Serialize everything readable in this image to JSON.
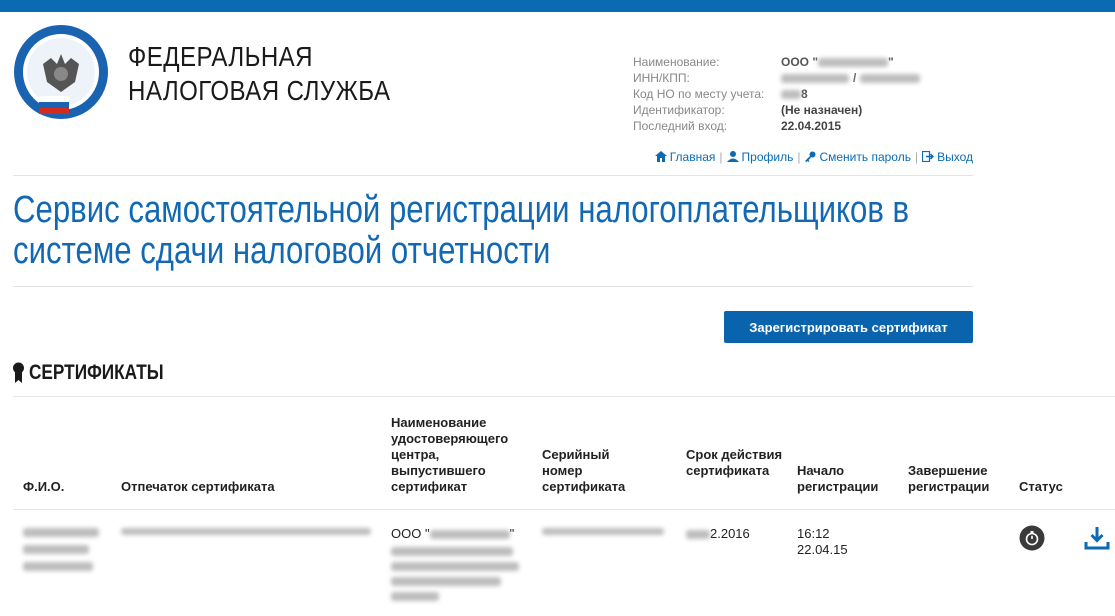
{
  "header": {
    "brand_line1": "ФЕДЕРАЛЬНАЯ",
    "brand_line2": "НАЛОГОВАЯ СЛУЖБА",
    "accent_color": "#0a6bb3"
  },
  "account": {
    "name_label": "Наименование:",
    "name_value_prefix": "ООО \"",
    "name_value_suffix": "\"",
    "inn_label": "ИНН/КПП:",
    "inn_separator": "/",
    "code_label": "Код НО по месту учета:",
    "code_value_suffix": "8",
    "id_label": "Идентификатор:",
    "id_value": "(Не назначен)",
    "last_login_label": "Последний вход:",
    "last_login_value": "22.04.2015"
  },
  "nav": {
    "home": "Главная",
    "profile": "Профиль",
    "change_password": "Сменить пароль",
    "logout": "Выход",
    "separator": "|"
  },
  "page": {
    "title_line1": "Сервис самостоятельной регистрации налогоплательщиков в",
    "title_line2": "системе сдачи налоговой отчетности",
    "register_button": "Зарегистрировать сертификат",
    "section_title": "СЕРТИФИКАТЫ"
  },
  "table": {
    "columns": {
      "fio": "Ф.И.О.",
      "thumbprint": "Отпечаток сертификата",
      "issuer": "Наименование удостоверяющего центра, выпустившего сертификат",
      "serial": "Серийный номер сертификата",
      "validity": "Срок действия сертификата",
      "reg_start": "Начало регистрации",
      "reg_end": "Завершение регистрации",
      "status": "Статус"
    },
    "rows": [
      {
        "issuer_prefix": "ООО \"",
        "issuer_suffix": "\"",
        "validity_visible": "2.2016",
        "reg_start_time": "16:12",
        "reg_start_date": "22.04.15",
        "reg_end": "",
        "status_icon": "clock-icon",
        "action_icon": "download-icon"
      }
    ]
  }
}
